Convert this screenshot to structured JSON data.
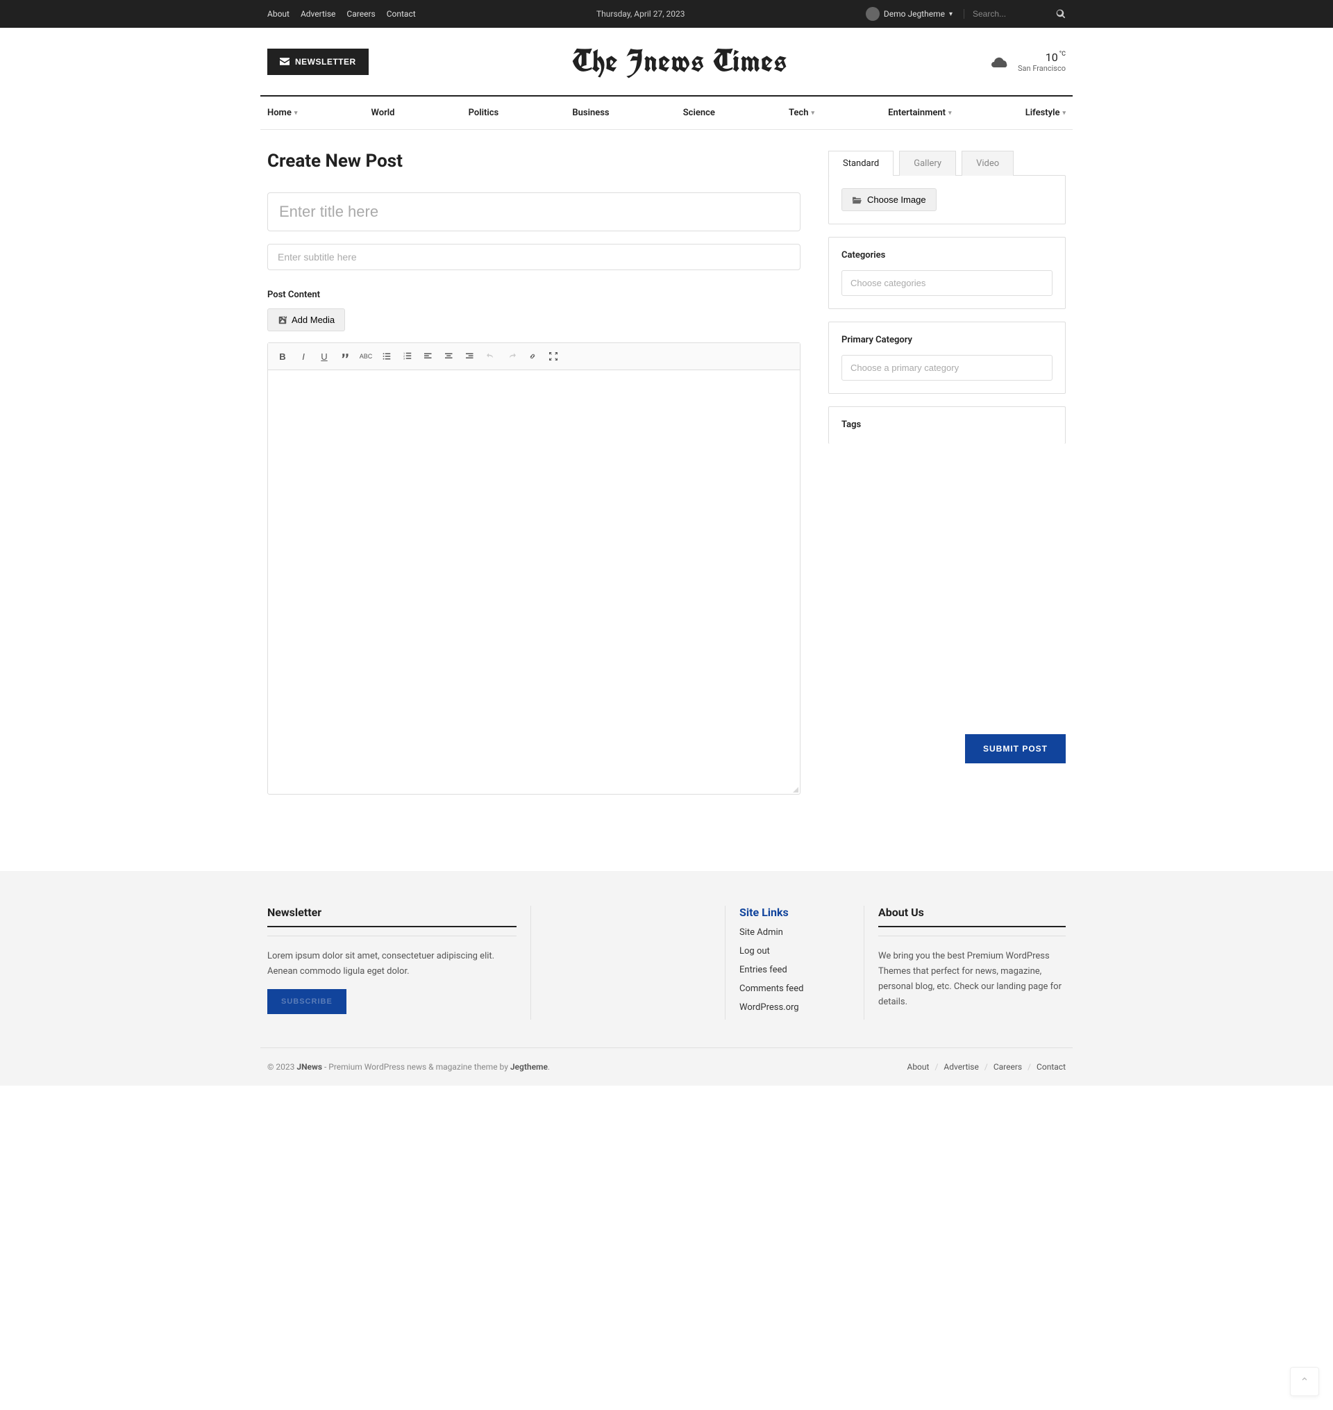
{
  "topbar": {
    "links": [
      "About",
      "Advertise",
      "Careers",
      "Contact"
    ],
    "date": "Thursday, April 27, 2023",
    "user": "Demo Jegtheme",
    "search_placeholder": "Search..."
  },
  "header": {
    "newsletter_label": "NEWSLETTER",
    "logo": "The Jnews Times",
    "weather": {
      "temp": "10",
      "unit": "°C",
      "city": "San Francisco"
    }
  },
  "nav": [
    "Home",
    "World",
    "Politics",
    "Business",
    "Science",
    "Tech",
    "Entertainment",
    "Lifestyle"
  ],
  "nav_dropdown": {
    "Home": true,
    "Tech": true,
    "Entertainment": true,
    "Lifestyle": true
  },
  "page": {
    "title": "Create New Post",
    "title_placeholder": "Enter title here",
    "subtitle_placeholder": "Enter subtitle here",
    "content_label": "Post Content",
    "add_media_label": "Add Media"
  },
  "sidebar": {
    "tabs": [
      "Standard",
      "Gallery",
      "Video"
    ],
    "choose_image_label": "Choose Image",
    "categories_label": "Categories",
    "categories_placeholder": "Choose categories",
    "primary_label": "Primary Category",
    "primary_placeholder": "Choose a primary category",
    "tags_label": "Tags",
    "submit_label": "SUBMIT POST"
  },
  "footer": {
    "newsletter": {
      "heading": "Newsletter",
      "text": "Lorem ipsum dolor sit amet, consectetuer adipiscing elit. Aenean commodo ligula eget dolor.",
      "button": "SUBSCRIBE"
    },
    "sitelinks": {
      "heading": "Site Links",
      "items": [
        "Site Admin",
        "Log out",
        "Entries feed",
        "Comments feed",
        "WordPress.org"
      ]
    },
    "about": {
      "heading": "About Us",
      "text": "We bring you the best Premium WordPress Themes that perfect for news, magazine, personal blog, etc. Check our landing page for details."
    },
    "copyright_prefix": "© 2023 ",
    "copyright_brand": "JNews",
    "copyright_mid": " - Premium WordPress news & magazine theme by ",
    "copyright_link": "Jegtheme",
    "bottom_links": [
      "About",
      "Advertise",
      "Careers",
      "Contact"
    ]
  }
}
